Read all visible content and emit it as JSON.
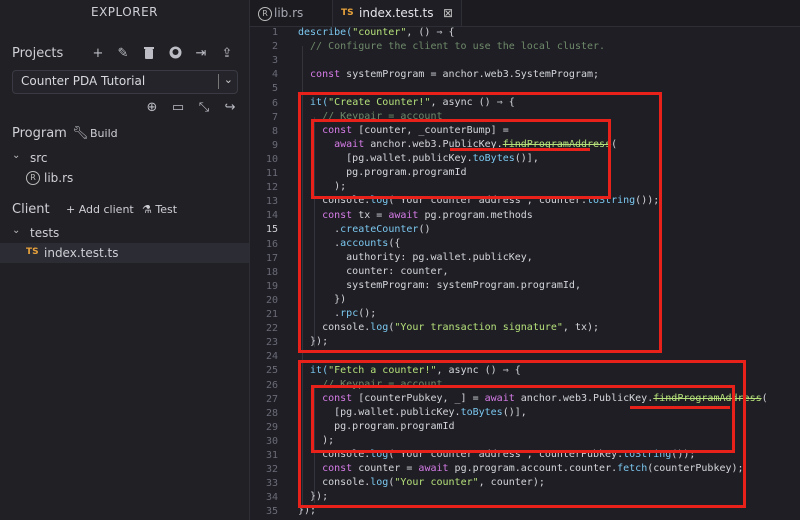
{
  "sidebar": {
    "title": "EXPLORER",
    "projects_label": "Projects",
    "project_select": {
      "value": "Counter PDA Tutorial"
    },
    "program_label": "Program",
    "build_label": "Build",
    "client_label": "Client",
    "add_client_label": "Add client",
    "test_label": "Test",
    "tree": {
      "src_folder": "src",
      "lib_file": "lib.rs",
      "tests_folder": "tests",
      "test_file": "index.test.ts",
      "ts_badge": "TS"
    }
  },
  "tabs": [
    {
      "label": "lib.rs"
    },
    {
      "label": "index.test.ts",
      "badge": "TS"
    }
  ],
  "editor": {
    "current_line": 15,
    "lines": [
      "1",
      "2",
      "3",
      "4",
      "5",
      "6",
      "7",
      "8",
      "9",
      "10",
      "11",
      "12",
      "13",
      "14",
      "15",
      "16",
      "17",
      "18",
      "19",
      "20",
      "21",
      "22",
      "23",
      "24",
      "25",
      "26",
      "27",
      "28",
      "29",
      "30",
      "31",
      "32",
      "33",
      "34",
      "35"
    ],
    "code": {
      "l1a": "describe(",
      "l1b": "\"counter\"",
      "l1c": ", () ⇒ {",
      "l2": "  // Configure the client to use the local cluster.",
      "l4a": "  const",
      "l4b": " systemProgram = anchor.web3.SystemProgram;",
      "l6a": "  it(",
      "l6b": "\"Create Counter!\"",
      "l6c": ", async () ⇒ {",
      "l7": "    // Keypair = account",
      "l8a": "    const",
      "l8b": " [counter, _counterBump] =",
      "l9a": "      await",
      "l9b": " anchor.web3.PublicKey.",
      "l9c": "findProgramAddress",
      "l9d": "(",
      "l10a": "        [pg.wallet.publicKey.",
      "l10b": "toBytes",
      "l10c": "()],",
      "l11": "        pg.program.programId",
      "l12": "      );",
      "l13a": "    console.",
      "l13b": "log",
      "l13c": "(\"Your counter address\", counter.",
      "l13d": "toString",
      "l13e": "());",
      "l14a": "    const",
      "l14b": " tx = ",
      "l14c": "await",
      "l14d": " pg.program.methods",
      "l15a": "      .",
      "l15b": "createCounter",
      "l15c": "()",
      "l16a": "      .",
      "l16b": "accounts",
      "l16c": "({",
      "l17": "        authority: pg.wallet.publicKey,",
      "l18": "        counter: counter,",
      "l19": "        systemProgram: systemProgram.programId,",
      "l20": "      })",
      "l21a": "      .",
      "l21b": "rpc",
      "l21c": "();",
      "l22a": "    console.",
      "l22b": "log",
      "l22c": "(",
      "l22d": "\"Your transaction signature\"",
      "l22e": ", tx);",
      "l23": "  });",
      "l25a": "  it(",
      "l25b": "\"Fetch a counter!\"",
      "l25c": ", async () ⇒ {",
      "l26": "    // Keypair = account",
      "l27a": "    const",
      "l27b": " [counterPubkey, _] = ",
      "l27c": "await",
      "l27d": " anchor.web3.PublicKey.",
      "l27e": "findProgramAddress",
      "l27f": "(",
      "l28a": "      [pg.wallet.publicKey.",
      "l28b": "toBytes",
      "l28c": "()],",
      "l29": "      pg.program.programId",
      "l30": "    );",
      "l31a": "    console.",
      "l31b": "log",
      "l31c": "(\"Your counter address\", counterPubkey.",
      "l31d": "toString",
      "l31e": "());",
      "l32a": "    const",
      "l32b": " counter = ",
      "l32c": "await",
      "l32d": " pg.program.account.counter.",
      "l32e": "fetch",
      "l32f": "(counterPubkey);",
      "l33a": "    console.",
      "l33b": "log",
      "l33c": "(",
      "l33d": "\"Your counter\"",
      "l33e": ", counter);",
      "l34": "  });",
      "l35": "});"
    }
  },
  "colors": {
    "annotation_red": "#e8221b",
    "ts_badge": "#e8a23b",
    "string_green": "#b5e07a",
    "keyword_purple": "#d77ce8",
    "function_blue": "#7cc8f0"
  }
}
